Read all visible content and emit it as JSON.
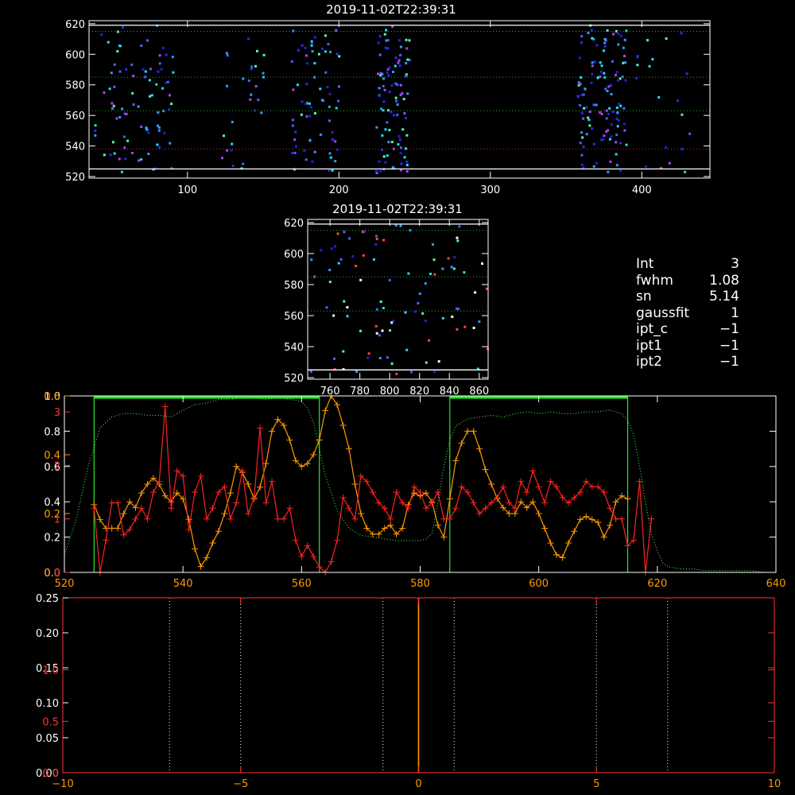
{
  "chart_data": [
    {
      "id": "spectrogram-main",
      "type": "heatmap",
      "title": "2019-11-02T22:39:31",
      "xlim": [
        35,
        445
      ],
      "ylim": [
        519,
        622
      ],
      "xticks": [
        100,
        200,
        300,
        400
      ],
      "yticks": [
        520,
        540,
        560,
        580,
        600,
        620
      ],
      "boundary_lines": [
        525,
        619
      ],
      "dotted_lines": [
        {
          "y": 538,
          "color": "#cc2222"
        },
        {
          "y": 563,
          "color": "#22aa22"
        },
        {
          "y": 585,
          "color": "#22aa22"
        },
        {
          "y": 615,
          "color": "#22aa22"
        }
      ],
      "point_colors": [
        "#2222dd",
        "#2a2aff",
        "#4466ff",
        "#3399ff",
        "#22ddff",
        "#55ffaa",
        "#aa44ff"
      ],
      "time_blocks": [
        {
          "x": [
            38,
            90
          ],
          "count": 85
        },
        {
          "x": [
            122,
            150
          ],
          "count": 28
        },
        {
          "x": [
            168,
            200
          ],
          "count": 70
        },
        {
          "x": [
            224,
            246
          ],
          "count": 95
        },
        {
          "x": [
            357,
            390
          ],
          "count": 120
        },
        {
          "x": [
            395,
            432
          ],
          "count": 20
        }
      ]
    },
    {
      "id": "spectrogram-zoom",
      "type": "heatmap",
      "title": "2019-11-02T22:39:31",
      "xlim": [
        745,
        866
      ],
      "ylim": [
        519,
        622
      ],
      "xticks": [
        760,
        780,
        800,
        820,
        840,
        860
      ],
      "yticks": [
        520,
        540,
        560,
        580,
        600,
        620
      ],
      "boundary_lines": [
        525,
        619
      ],
      "dotted_lines": [
        {
          "y": 563,
          "color": "#22aa22"
        },
        {
          "y": 585,
          "color": "#22aa22"
        },
        {
          "y": 615,
          "color": "#22aa22"
        }
      ],
      "point_colors": [
        "#2222dd",
        "#4466ff",
        "#3399ff",
        "#22ddff",
        "#55ffaa",
        "#ff4444",
        "#ffffff"
      ],
      "time_blocks": [
        {
          "x": [
            746,
            865
          ],
          "count": 95
        }
      ]
    },
    {
      "id": "profile-plot",
      "type": "line",
      "xlim": [
        520,
        640
      ],
      "xticks": [
        520,
        540,
        560,
        580,
        600,
        620,
        640
      ],
      "y_axes": [
        {
          "name": "white",
          "color": "#ffffff",
          "ticks": [
            {
              "v": 0.0,
              "label": "0.0"
            },
            {
              "v": 0.2,
              "label": "0.2"
            },
            {
              "v": 0.4,
              "label": "0.4"
            },
            {
              "v": 0.6,
              "label": "0.6"
            },
            {
              "v": 0.8,
              "label": "0.8"
            },
            {
              "v": 1.0,
              "label": "1.0"
            }
          ],
          "range": [
            0,
            1.0
          ]
        },
        {
          "name": "orange",
          "color": "#ff9900",
          "ticks": [
            {
              "v": 0.0,
              "label": "0.0"
            },
            {
              "v": 0.2,
              "label": "0.2"
            },
            {
              "v": 0.4,
              "label": "0.4"
            },
            {
              "v": 0.6,
              "label": "0.6"
            }
          ],
          "range": [
            0,
            0.6
          ]
        },
        {
          "name": "red",
          "color": "#ff3333",
          "ticks": [
            {
              "v": 0,
              "label": "0"
            },
            {
              "v": 1,
              "label": "1"
            },
            {
              "v": 2,
              "label": "2"
            },
            {
              "v": 3,
              "label": "3"
            }
          ],
          "range": [
            0,
            3.3
          ]
        }
      ],
      "green_windows": [
        [
          525,
          563
        ],
        [
          585,
          615
        ]
      ],
      "series": [
        {
          "color": "#ff9900",
          "axis": "orange",
          "x": [
            525,
            526,
            527,
            528,
            529,
            530,
            531,
            532,
            533,
            534,
            535,
            536,
            537,
            538,
            539,
            540,
            541,
            542,
            543,
            544,
            545,
            546,
            547,
            548,
            549,
            550,
            551,
            552,
            553,
            554,
            555,
            556,
            557,
            558,
            559,
            560,
            561,
            562,
            563,
            564,
            565,
            566,
            567,
            568,
            569,
            570,
            571,
            572,
            573,
            574,
            575,
            576,
            577,
            578,
            579,
            580,
            581,
            582,
            583,
            584,
            585,
            586,
            587,
            588,
            589,
            590,
            591,
            592,
            593,
            594,
            595,
            596,
            597,
            598,
            599,
            600,
            601,
            602,
            603,
            604,
            605,
            606,
            607,
            608,
            609,
            610,
            611,
            612,
            613,
            614,
            615
          ],
          "y": [
            0.23,
            0.18,
            0.15,
            0.15,
            0.15,
            0.2,
            0.24,
            0.22,
            0.27,
            0.3,
            0.32,
            0.3,
            0.26,
            0.24,
            0.27,
            0.25,
            0.18,
            0.08,
            0.02,
            0.05,
            0.1,
            0.14,
            0.2,
            0.27,
            0.36,
            0.34,
            0.3,
            0.25,
            0.29,
            0.37,
            0.48,
            0.52,
            0.5,
            0.45,
            0.38,
            0.36,
            0.37,
            0.4,
            0.45,
            0.55,
            0.6,
            0.57,
            0.5,
            0.42,
            0.3,
            0.2,
            0.15,
            0.13,
            0.13,
            0.15,
            0.16,
            0.13,
            0.15,
            0.23,
            0.27,
            0.26,
            0.27,
            0.24,
            0.16,
            0.12,
            0.25,
            0.38,
            0.44,
            0.48,
            0.48,
            0.42,
            0.35,
            0.3,
            0.25,
            0.22,
            0.2,
            0.2,
            0.24,
            0.22,
            0.24,
            0.2,
            0.15,
            0.1,
            0.06,
            0.05,
            0.1,
            0.14,
            0.18,
            0.19,
            0.18,
            0.17,
            0.12,
            0.16,
            0.24,
            0.26,
            0.25
          ]
        },
        {
          "color": "#ff2222",
          "axis": "red",
          "x": [
            525,
            526,
            527,
            528,
            529,
            530,
            531,
            532,
            533,
            534,
            535,
            536,
            537,
            538,
            539,
            540,
            541,
            542,
            543,
            544,
            545,
            546,
            547,
            548,
            549,
            550,
            551,
            552,
            553,
            554,
            555,
            556,
            557,
            558,
            559,
            560,
            561,
            562,
            563,
            564,
            565,
            566,
            567,
            568,
            569,
            570,
            571,
            572,
            573,
            574,
            575,
            576,
            577,
            578,
            579,
            580,
            581,
            582,
            583,
            584,
            585,
            586,
            587,
            588,
            589,
            590,
            591,
            592,
            593,
            594,
            595,
            596,
            597,
            598,
            599,
            600,
            601,
            602,
            603,
            604,
            605,
            606,
            607,
            608,
            609,
            610,
            611,
            612,
            613,
            614,
            615,
            616,
            617,
            618,
            619
          ],
          "y": [
            1.2,
            0.0,
            0.6,
            1.3,
            1.3,
            0.7,
            0.8,
            1.0,
            1.2,
            1.0,
            1.5,
            1.7,
            3.1,
            1.2,
            1.9,
            1.8,
            0.8,
            1.5,
            1.8,
            1.0,
            1.2,
            1.5,
            1.6,
            1.0,
            1.3,
            1.9,
            1.1,
            1.4,
            2.7,
            1.3,
            1.7,
            1.0,
            1.0,
            1.2,
            0.6,
            0.3,
            0.5,
            0.3,
            0.1,
            0.0,
            0.2,
            0.6,
            1.4,
            1.2,
            1.0,
            1.8,
            1.7,
            1.5,
            1.3,
            1.2,
            1.0,
            1.5,
            1.3,
            1.2,
            1.6,
            1.5,
            1.2,
            1.3,
            1.5,
            1.0,
            1.0,
            1.2,
            1.6,
            1.5,
            1.3,
            1.1,
            1.2,
            1.3,
            1.4,
            1.6,
            1.3,
            1.2,
            1.7,
            1.5,
            1.9,
            1.6,
            1.3,
            1.7,
            1.6,
            1.4,
            1.3,
            1.4,
            1.5,
            1.7,
            1.6,
            1.6,
            1.5,
            1.2,
            1.0,
            1.0,
            0.5,
            0.6,
            1.7,
            0.0,
            1.0
          ]
        },
        {
          "color": "#55ff55",
          "axis": "white",
          "dotted": true,
          "x": [
            520,
            522,
            524,
            526,
            528,
            530,
            532,
            534,
            536,
            538,
            540,
            542,
            544,
            546,
            548,
            550,
            552,
            554,
            556,
            558,
            560,
            561,
            562,
            563,
            564,
            565,
            566,
            568,
            570,
            572,
            574,
            576,
            578,
            580,
            581,
            582,
            583,
            584,
            585,
            586,
            588,
            590,
            592,
            594,
            596,
            598,
            600,
            602,
            604,
            606,
            608,
            610,
            612,
            614,
            615,
            616,
            617,
            618,
            619,
            620,
            621,
            622,
            624,
            626,
            628,
            630,
            632,
            634,
            636,
            638,
            640
          ],
          "y": [
            0.1,
            0.3,
            0.6,
            0.82,
            0.88,
            0.9,
            0.9,
            0.89,
            0.89,
            0.88,
            0.92,
            0.95,
            0.96,
            0.98,
            0.98,
            0.99,
            0.99,
            0.98,
            0.99,
            0.98,
            0.97,
            0.93,
            0.85,
            0.7,
            0.55,
            0.45,
            0.35,
            0.25,
            0.21,
            0.2,
            0.19,
            0.18,
            0.18,
            0.18,
            0.19,
            0.22,
            0.4,
            0.6,
            0.75,
            0.83,
            0.87,
            0.88,
            0.89,
            0.88,
            0.9,
            0.91,
            0.9,
            0.91,
            0.9,
            0.9,
            0.91,
            0.91,
            0.92,
            0.9,
            0.86,
            0.78,
            0.6,
            0.4,
            0.22,
            0.12,
            0.05,
            0.03,
            0.02,
            0.02,
            0.01,
            0.01,
            0.01,
            0.01,
            0.01,
            0.0,
            0.0
          ]
        }
      ]
    },
    {
      "id": "lower-plot",
      "type": "line",
      "xlim": [
        -10,
        10
      ],
      "xticks": [
        -10,
        -5,
        0,
        5,
        10
      ],
      "y_axes": [
        {
          "name": "white",
          "color": "#ffffff",
          "ticks": [
            {
              "v": 0.0,
              "label": "0.00"
            },
            {
              "v": 0.05,
              "label": "0.05"
            },
            {
              "v": 0.1,
              "label": "0.10"
            },
            {
              "v": 0.15,
              "label": "0.15"
            },
            {
              "v": 0.2,
              "label": "0.20"
            },
            {
              "v": 0.25,
              "label": "0.25"
            }
          ],
          "range": [
            0,
            0.25
          ]
        },
        {
          "name": "red",
          "color": "#ff3333",
          "ticks": [
            {
              "v": 0.0,
              "label": "0.0"
            },
            {
              "v": 0.5,
              "label": "0.5"
            },
            {
              "v": 1.0,
              "label": "1.0"
            }
          ],
          "range": [
            0,
            1.7
          ]
        }
      ],
      "vertical_lines": [
        {
          "x": -7,
          "style": "dotted"
        },
        {
          "x": -5,
          "style": "dotted"
        },
        {
          "x": -1,
          "style": "dotted"
        },
        {
          "x": 1,
          "style": "dotted"
        },
        {
          "x": 5,
          "style": "dotted"
        },
        {
          "x": 7,
          "style": "dotted"
        },
        {
          "x": 0,
          "style": "solid",
          "color": "#ff9900"
        }
      ]
    }
  ],
  "params": [
    {
      "key": "Int",
      "value": "3"
    },
    {
      "key": "fwhm",
      "value": "1.08"
    },
    {
      "key": "sn",
      "value": "5.14"
    },
    {
      "key": "gaussfit",
      "value": "1"
    },
    {
      "key": "ipt_c",
      "value": "−1"
    },
    {
      "key": "ipt1",
      "value": "−1"
    },
    {
      "key": "ipt2",
      "value": "−1"
    }
  ]
}
